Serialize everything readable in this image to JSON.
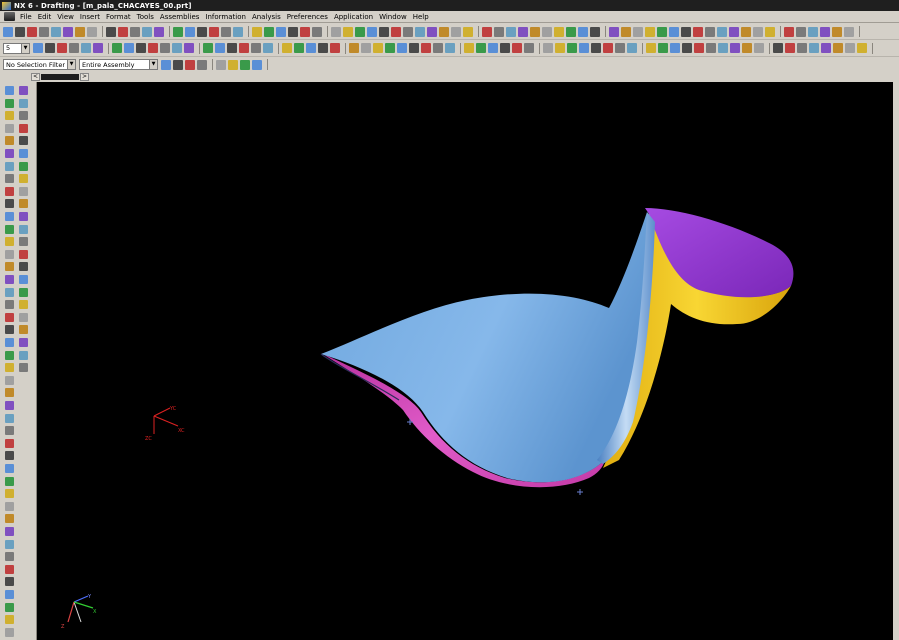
{
  "window": {
    "title": "NX 6 - Drafting - [m_pala_CHACAYES_00.prt]"
  },
  "menu": {
    "items": [
      "File",
      "Edit",
      "View",
      "Insert",
      "Format",
      "Tools",
      "Assemblies",
      "Information",
      "Analysis",
      "Preferences",
      "Application",
      "Window",
      "Help"
    ]
  },
  "toolbar_top": {
    "scale_value": "5"
  },
  "selection_bar": {
    "type_filter": "No Selection Filter",
    "scope": "Entire Assembly"
  },
  "tabstrip": {
    "left_arrow": "<",
    "right_arrow": ">"
  },
  "viewport": {
    "background": "#000000",
    "surface_colors": {
      "main_face": "#7fb2e5",
      "root_fillet": "#d24ac0",
      "edge_band": "#f2c81e",
      "top_face": "#9b3fd8"
    },
    "view_triad_labels": {
      "x": "XC",
      "y": "YC",
      "z": "ZC"
    },
    "absolute_triad_labels": {
      "x": "X",
      "y": "Y",
      "z": "Z"
    }
  },
  "colors": {
    "chrome": "#d4d0c8",
    "titlebar": "#1f1f1f"
  }
}
